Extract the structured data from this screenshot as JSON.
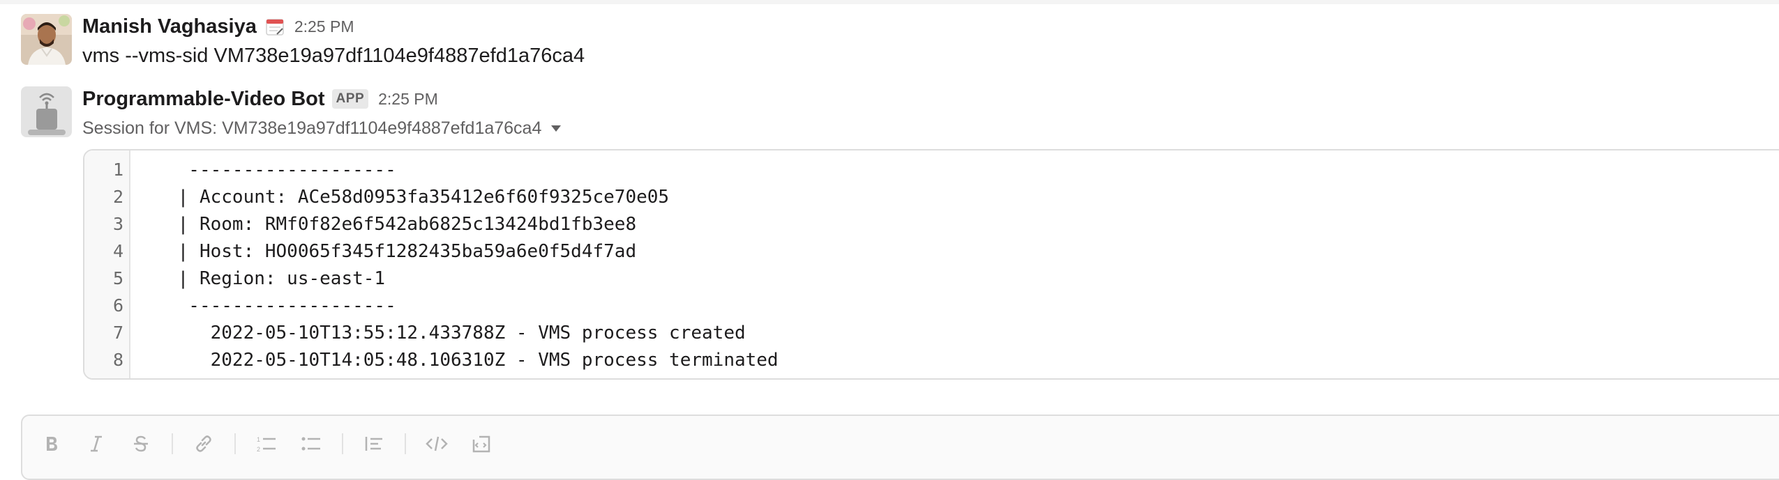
{
  "messages": [
    {
      "sender": "Manish Vaghasiya",
      "status_emoji": "calendar-icon",
      "time": "2:25 PM",
      "text": "vms --vms-sid VM738e19a97df1104e9f4887efd1a76ca4"
    },
    {
      "sender": "Programmable-Video Bot",
      "badge": "APP",
      "time": "2:25 PM",
      "attachment_title": "Session for VMS: VM738e19a97df1104e9f4887efd1a76ca4",
      "code_lines": [
        "  -------------------",
        " | Account: ACe58d0953fa35412e6f60f9325ce70e05",
        " | Room: RMf0f82e6f542ab6825c13424bd1fb3ee8",
        " | Host: HO0065f345f1282435ba59a6e0f5d4f7ad",
        " | Region: us-east-1",
        "  -------------------",
        "    2022-05-10T13:55:12.433788Z - VMS process created",
        "    2022-05-10T14:05:48.106310Z - VMS process terminated"
      ],
      "line_numbers": [
        "1",
        "2",
        "3",
        "4",
        "5",
        "6",
        "7",
        "8"
      ]
    }
  ],
  "composer": {
    "toolbar_icons": [
      "bold-icon",
      "italic-icon",
      "strikethrough-icon",
      "link-icon",
      "ordered-list-icon",
      "bulleted-list-icon",
      "blockquote-icon",
      "code-icon",
      "code-block-icon"
    ]
  },
  "colors": {
    "text": "#1d1c1d",
    "muted": "#616061",
    "border": "#dddddd",
    "toolbar_icon": "#b3b3b3"
  }
}
